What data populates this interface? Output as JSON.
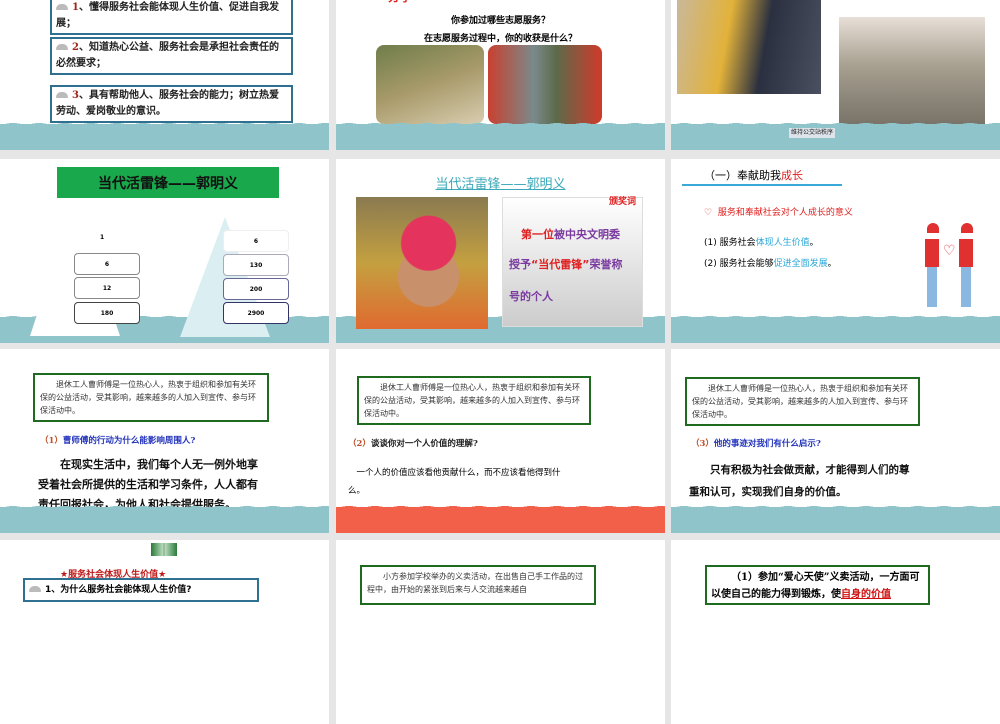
{
  "slides": [
    {
      "objectives": [
        {
          "num": "1",
          "text": "、懂得服务社会能体现人生价值、促进自我发展；"
        },
        {
          "num": "2",
          "text": "、知道热心公益、服务社会是承担社会责任的必然要求；"
        },
        {
          "num": "3",
          "text": "、具有帮助他人、服务社会的能力；树立热爱劳动、爱岗敬业的意识。"
        }
      ]
    },
    {
      "heading": "分享",
      "q1": "你参加过哪些志愿服务？",
      "q2": "在志愿服务过程中，你的收获是什么？"
    },
    {
      "caption": "维持公交站秩序"
    },
    {
      "title": "当代活雷锋——郭明义",
      "left_values": [
        "1",
        "6",
        "12",
        "180"
      ],
      "right_values": [
        "6",
        "130",
        "200",
        "2900"
      ]
    },
    {
      "title": "当代活雷锋——郭明义",
      "award_label": "颁奖词",
      "line1_red": "第一位",
      "line1": "被中央文明委",
      "line2_a": "授予",
      "line2_red": "“当代雷锋”",
      "line2_b": "荣誉称",
      "line3": "号的个人"
    },
    {
      "title_a": "（一）奉献助我",
      "title_red": "成长",
      "point": "服务和奉献社会对个人成长的意义",
      "item1_a": "(1) 服务社会",
      "item1_b": "体现人生价值",
      "item1_c": "。",
      "item2_a": "(2) 服务社会能够",
      "item2_b": "促进全面发展",
      "item2_c": "。"
    },
    {
      "story": "退休工人曹师傅是一位热心人，热衷于组织和参加有关环保的公益活动，受其影响，越来越多的人加入到宣传、参与环保活动中。",
      "q_num": "（1）",
      "question": "曹师傅的行动为什么能影响周围人?",
      "answer": "在现实生活中，我们每个人无一例外地享受着社会所提供的生活和学习条件，人人都有责任回报社会，为他人和社会提供服务。"
    },
    {
      "story": "退休工人曹师傅是一位热心人，热衷于组织和参加有关环保的公益活动，受其影响，越来越多的人加入到宣传、参与环保活动中。",
      "q_num": "（2）",
      "question": "谈谈你对一个人价值的理解?",
      "answer": "一个人的价值应该看他贡献什么，而不应该看他得到什么。"
    },
    {
      "story": "退休工人曹师傅是一位热心人，热衷于组织和参加有关环保的公益活动，受其影响，越来越多的人加入到宣传、参与环保活动中。",
      "q_num": "（3）",
      "question": "他的事迹对我们有什么启示?",
      "answer": "只有积极为社会做贡献，才能得到人们的尊重和认可，实现我们自身的价值。"
    },
    {
      "title": "★服务社会体现人生价值★",
      "q": "1、为什么服务社会能体现人生价值?"
    },
    {
      "story": "小方参加学校举办的义卖活动，在出售自己手工作品的过程中，由开始的紧张到后来与人交流越来越自"
    },
    {
      "text_a": "（1）参加“爱心天使”义卖活动，一方面可以使自己的能力得到锻炼，使",
      "text_red": "自身的价值"
    }
  ],
  "colors": {
    "band": "#8fc4cb",
    "band_alt": "#f2604a",
    "title_green": "#1aa84c"
  }
}
